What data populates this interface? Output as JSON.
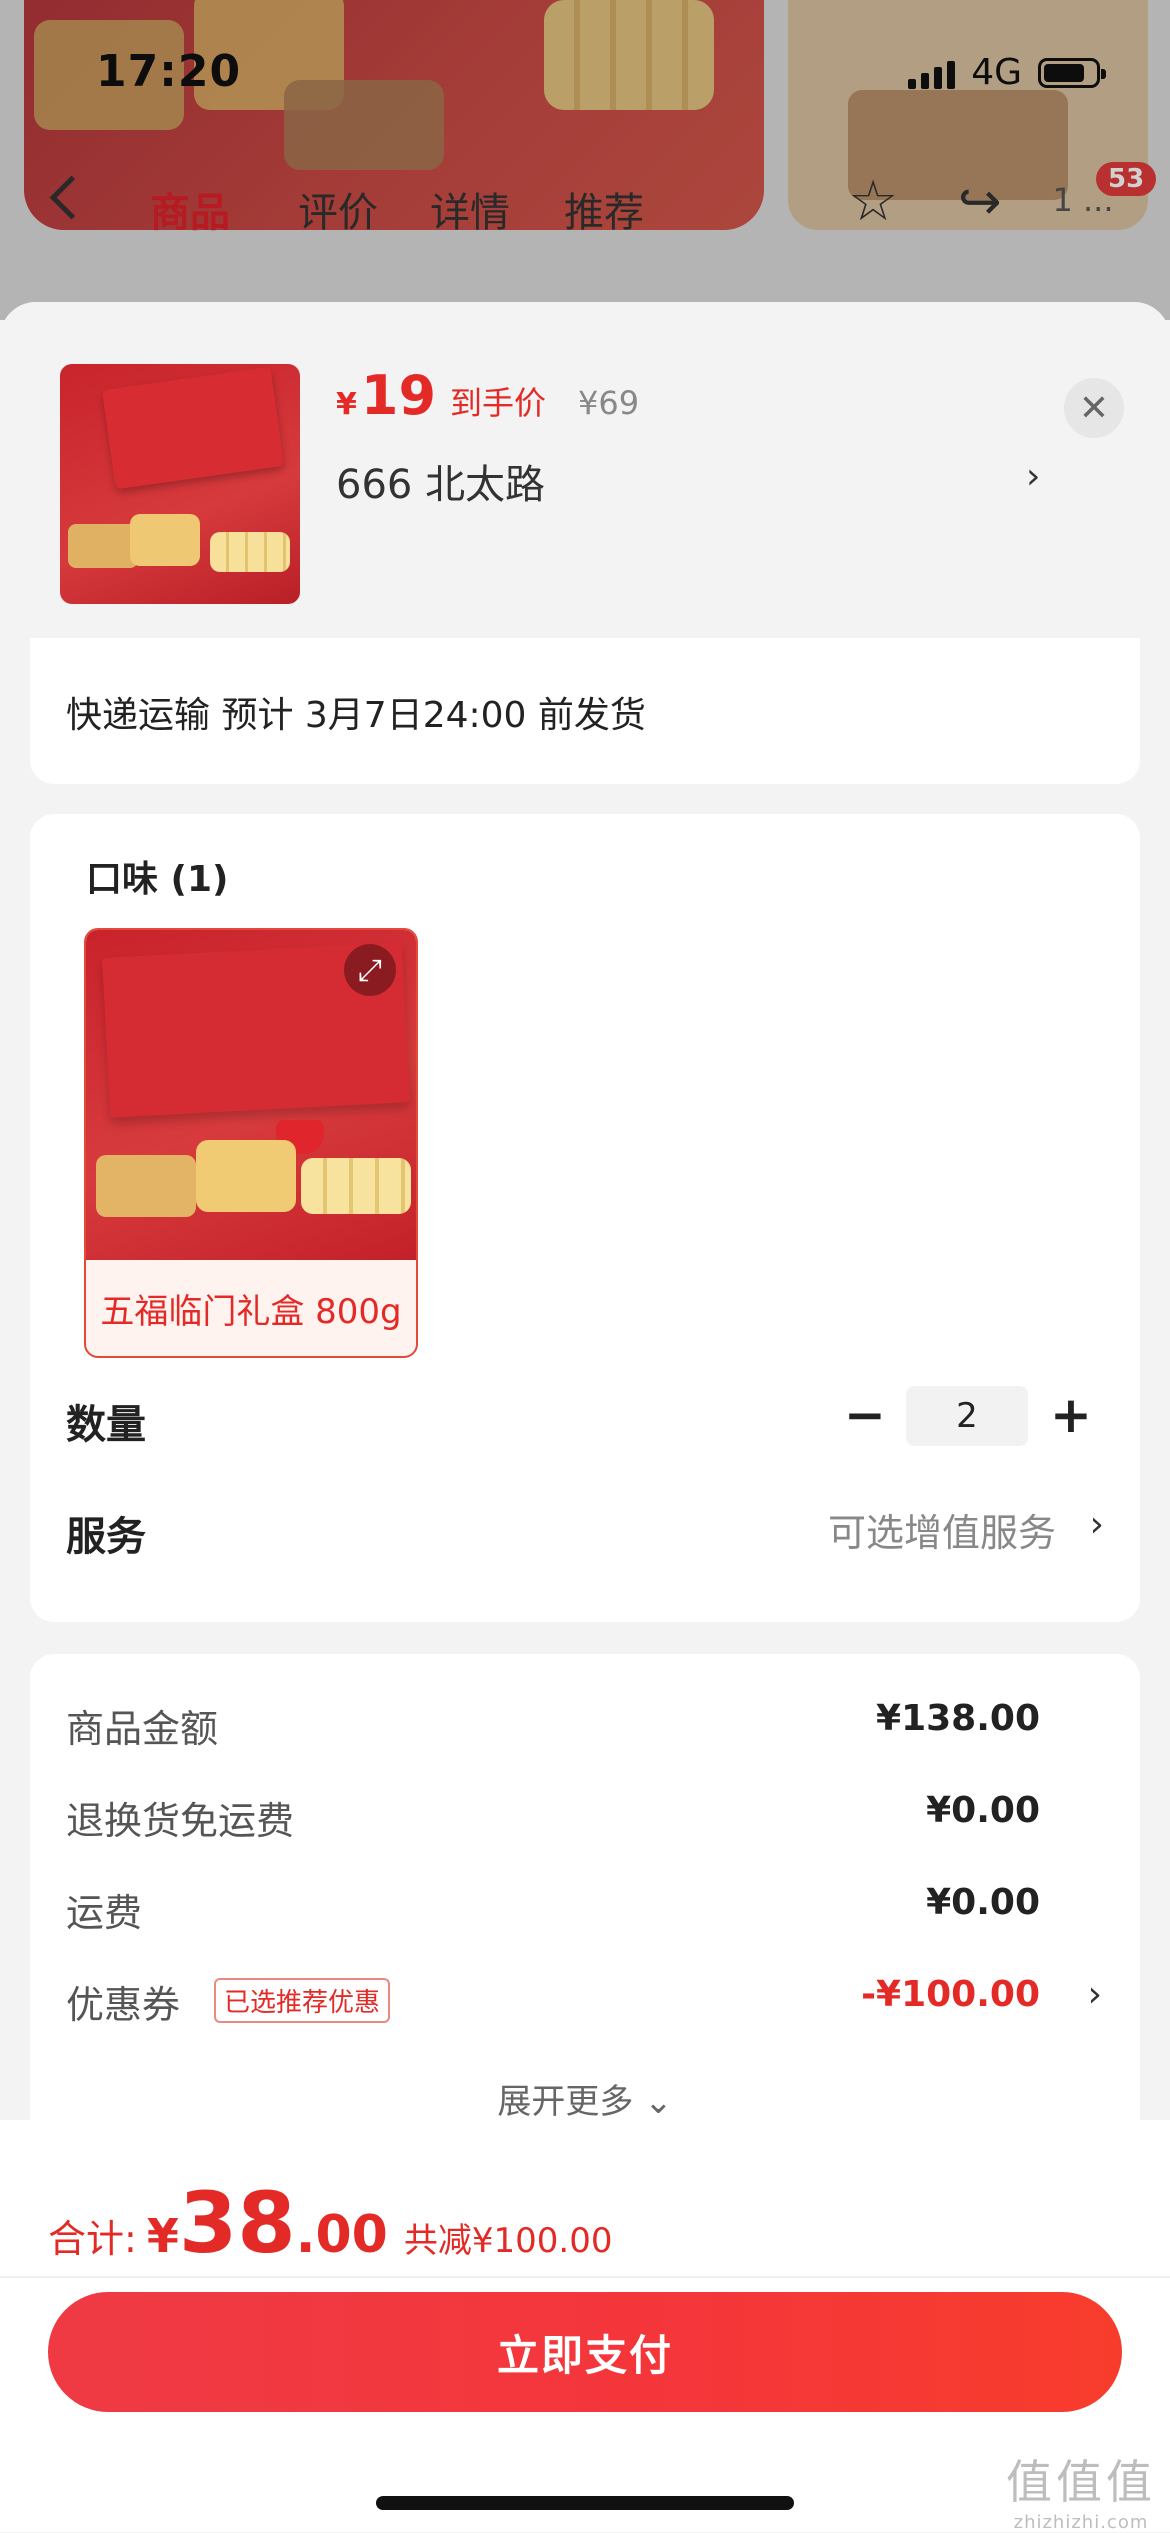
{
  "status_bar": {
    "time": "17:20",
    "network": "4G"
  },
  "background_nav": {
    "tabs": [
      "商品",
      "评价",
      "详情",
      "推荐"
    ],
    "active_tab": "商品",
    "more_badge": "53",
    "more_text": "1 ..."
  },
  "sku_header": {
    "price_symbol": "¥",
    "price": "19",
    "price_tag": "到手价",
    "original_price": "¥69",
    "address": "666  北太路"
  },
  "shipping": {
    "text": "快递运输 预计 3月7日24:00 前发货"
  },
  "options": {
    "title": "口味 (1)",
    "items": [
      {
        "label": "五福临门礼盒 800g",
        "selected": true
      }
    ]
  },
  "quantity": {
    "label": "数量",
    "value": "2"
  },
  "service": {
    "label": "服务",
    "value": "可选增值服务"
  },
  "fees": [
    {
      "label": "商品金额",
      "value": "¥138.00"
    },
    {
      "label": "退换货免运费",
      "value": "¥0.00"
    },
    {
      "label": "运费",
      "value": "¥0.00"
    },
    {
      "label": "优惠券",
      "tag": "已选推荐优惠",
      "value": "-¥100.00"
    }
  ],
  "expand_more": "展开更多 ⌄",
  "total": {
    "label": "合计:",
    "symbol": "¥",
    "integer": "38",
    "decimal": ".00",
    "saved": "共减¥100.00"
  },
  "pay_button": "立即支付",
  "watermark": {
    "mark": "值值值",
    "text": "zhizhizhi.com"
  },
  "colors": {
    "accent": "#e42a26",
    "button_start": "#ef3a44",
    "button_end": "#f83c2c"
  }
}
